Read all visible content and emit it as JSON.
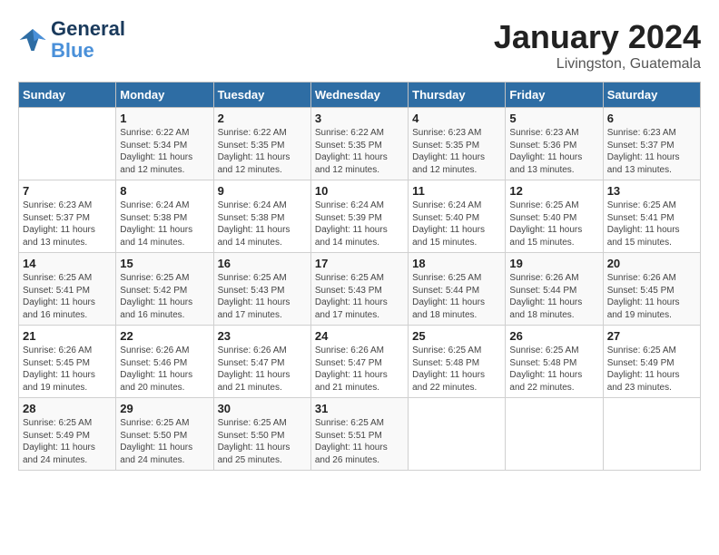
{
  "logo": {
    "text_general": "General",
    "text_blue": "Blue"
  },
  "title": "January 2024",
  "location": "Livingston, Guatemala",
  "days_of_week": [
    "Sunday",
    "Monday",
    "Tuesday",
    "Wednesday",
    "Thursday",
    "Friday",
    "Saturday"
  ],
  "weeks": [
    [
      {
        "day": "",
        "info": ""
      },
      {
        "day": "1",
        "info": "Sunrise: 6:22 AM\nSunset: 5:34 PM\nDaylight: 11 hours\nand 12 minutes."
      },
      {
        "day": "2",
        "info": "Sunrise: 6:22 AM\nSunset: 5:35 PM\nDaylight: 11 hours\nand 12 minutes."
      },
      {
        "day": "3",
        "info": "Sunrise: 6:22 AM\nSunset: 5:35 PM\nDaylight: 11 hours\nand 12 minutes."
      },
      {
        "day": "4",
        "info": "Sunrise: 6:23 AM\nSunset: 5:35 PM\nDaylight: 11 hours\nand 12 minutes."
      },
      {
        "day": "5",
        "info": "Sunrise: 6:23 AM\nSunset: 5:36 PM\nDaylight: 11 hours\nand 13 minutes."
      },
      {
        "day": "6",
        "info": "Sunrise: 6:23 AM\nSunset: 5:37 PM\nDaylight: 11 hours\nand 13 minutes."
      }
    ],
    [
      {
        "day": "7",
        "info": "Sunrise: 6:23 AM\nSunset: 5:37 PM\nDaylight: 11 hours\nand 13 minutes."
      },
      {
        "day": "8",
        "info": "Sunrise: 6:24 AM\nSunset: 5:38 PM\nDaylight: 11 hours\nand 14 minutes."
      },
      {
        "day": "9",
        "info": "Sunrise: 6:24 AM\nSunset: 5:38 PM\nDaylight: 11 hours\nand 14 minutes."
      },
      {
        "day": "10",
        "info": "Sunrise: 6:24 AM\nSunset: 5:39 PM\nDaylight: 11 hours\nand 14 minutes."
      },
      {
        "day": "11",
        "info": "Sunrise: 6:24 AM\nSunset: 5:40 PM\nDaylight: 11 hours\nand 15 minutes."
      },
      {
        "day": "12",
        "info": "Sunrise: 6:25 AM\nSunset: 5:40 PM\nDaylight: 11 hours\nand 15 minutes."
      },
      {
        "day": "13",
        "info": "Sunrise: 6:25 AM\nSunset: 5:41 PM\nDaylight: 11 hours\nand 15 minutes."
      }
    ],
    [
      {
        "day": "14",
        "info": "Sunrise: 6:25 AM\nSunset: 5:41 PM\nDaylight: 11 hours\nand 16 minutes."
      },
      {
        "day": "15",
        "info": "Sunrise: 6:25 AM\nSunset: 5:42 PM\nDaylight: 11 hours\nand 16 minutes."
      },
      {
        "day": "16",
        "info": "Sunrise: 6:25 AM\nSunset: 5:43 PM\nDaylight: 11 hours\nand 17 minutes."
      },
      {
        "day": "17",
        "info": "Sunrise: 6:25 AM\nSunset: 5:43 PM\nDaylight: 11 hours\nand 17 minutes."
      },
      {
        "day": "18",
        "info": "Sunrise: 6:25 AM\nSunset: 5:44 PM\nDaylight: 11 hours\nand 18 minutes."
      },
      {
        "day": "19",
        "info": "Sunrise: 6:26 AM\nSunset: 5:44 PM\nDaylight: 11 hours\nand 18 minutes."
      },
      {
        "day": "20",
        "info": "Sunrise: 6:26 AM\nSunset: 5:45 PM\nDaylight: 11 hours\nand 19 minutes."
      }
    ],
    [
      {
        "day": "21",
        "info": "Sunrise: 6:26 AM\nSunset: 5:45 PM\nDaylight: 11 hours\nand 19 minutes."
      },
      {
        "day": "22",
        "info": "Sunrise: 6:26 AM\nSunset: 5:46 PM\nDaylight: 11 hours\nand 20 minutes."
      },
      {
        "day": "23",
        "info": "Sunrise: 6:26 AM\nSunset: 5:47 PM\nDaylight: 11 hours\nand 21 minutes."
      },
      {
        "day": "24",
        "info": "Sunrise: 6:26 AM\nSunset: 5:47 PM\nDaylight: 11 hours\nand 21 minutes."
      },
      {
        "day": "25",
        "info": "Sunrise: 6:25 AM\nSunset: 5:48 PM\nDaylight: 11 hours\nand 22 minutes."
      },
      {
        "day": "26",
        "info": "Sunrise: 6:25 AM\nSunset: 5:48 PM\nDaylight: 11 hours\nand 22 minutes."
      },
      {
        "day": "27",
        "info": "Sunrise: 6:25 AM\nSunset: 5:49 PM\nDaylight: 11 hours\nand 23 minutes."
      }
    ],
    [
      {
        "day": "28",
        "info": "Sunrise: 6:25 AM\nSunset: 5:49 PM\nDaylight: 11 hours\nand 24 minutes."
      },
      {
        "day": "29",
        "info": "Sunrise: 6:25 AM\nSunset: 5:50 PM\nDaylight: 11 hours\nand 24 minutes."
      },
      {
        "day": "30",
        "info": "Sunrise: 6:25 AM\nSunset: 5:50 PM\nDaylight: 11 hours\nand 25 minutes."
      },
      {
        "day": "31",
        "info": "Sunrise: 6:25 AM\nSunset: 5:51 PM\nDaylight: 11 hours\nand 26 minutes."
      },
      {
        "day": "",
        "info": ""
      },
      {
        "day": "",
        "info": ""
      },
      {
        "day": "",
        "info": ""
      }
    ]
  ]
}
